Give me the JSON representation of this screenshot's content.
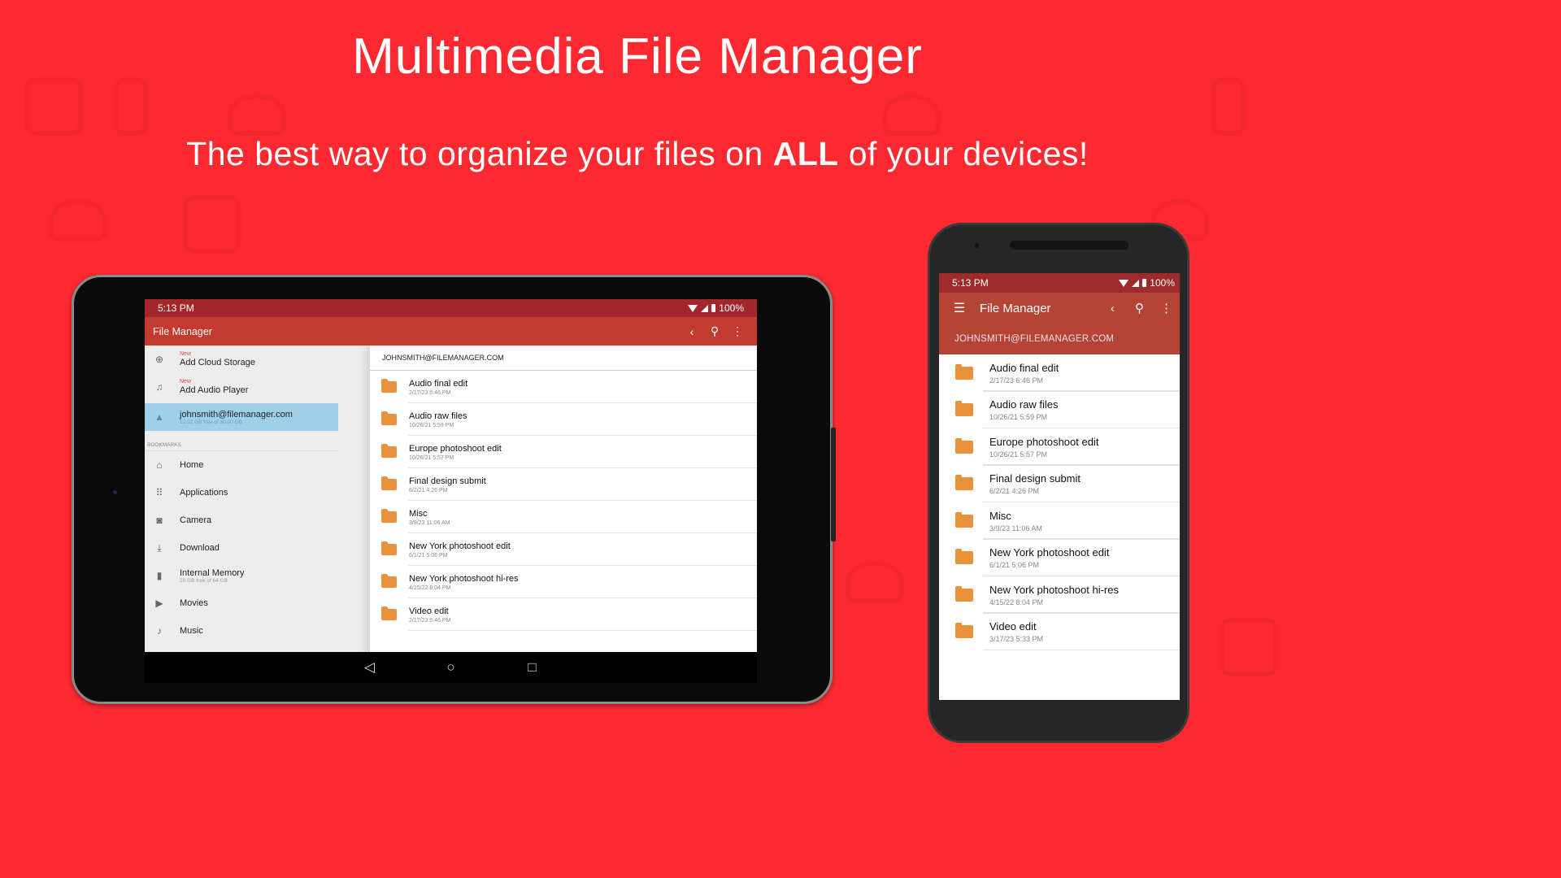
{
  "promo": {
    "headline": "Multimedia File Manager",
    "subline_before": "The best way to organize your files on ",
    "subline_bold": "ALL",
    "subline_after": " of your devices!",
    "background_color": "#fc2a30"
  },
  "status_bar": {
    "time": "5:13 PM",
    "battery": "100%",
    "icons": [
      "wifi-icon",
      "signal-icon",
      "battery-icon"
    ]
  },
  "app": {
    "title": "File Manager",
    "toolbar_icons": [
      "back-icon",
      "search-icon",
      "more-vert-icon"
    ],
    "primary_color": "#c33a30",
    "status_color": "#a2262a"
  },
  "tablet": {
    "sidebar": {
      "top_items": [
        {
          "badge": "New",
          "label": "Add Cloud Storage",
          "icon": "add-circle-icon"
        },
        {
          "badge": "New",
          "label": "Add Audio Player",
          "icon": "music-circle-icon"
        }
      ],
      "account": {
        "label": "johnsmith@filemanager.com",
        "sub": "12.32 GB free of 30.00 GB",
        "icon": "drive-icon"
      },
      "bookmarks_header": "BOOKMARKS",
      "bookmarks": [
        {
          "label": "Home",
          "icon": "home-icon"
        },
        {
          "label": "Applications",
          "icon": "apps-grid-icon"
        },
        {
          "label": "Camera",
          "icon": "camera-icon"
        },
        {
          "label": "Download",
          "icon": "download-icon"
        },
        {
          "label": "Internal Memory",
          "sub": "20 GB free of 64 GB",
          "icon": "sd-card-icon"
        },
        {
          "label": "Movies",
          "icon": "movies-icon"
        },
        {
          "label": "Music",
          "icon": "music-library-icon"
        }
      ]
    },
    "account_header": "JOHNSMITH@FILEMANAGER.COM",
    "files": [
      {
        "name": "Audio final edit",
        "date": "2/17/23 6:46 PM"
      },
      {
        "name": "Audio raw files",
        "date": "10/26/21 5:59 PM"
      },
      {
        "name": "Europe photoshoot edit",
        "date": "10/26/21 5:57 PM"
      },
      {
        "name": "Final design submit",
        "date": "6/2/21 4:26 PM"
      },
      {
        "name": "Misc",
        "date": "3/9/23 11:06 AM"
      },
      {
        "name": "New York photoshoot edit",
        "date": "6/1/21 5:06 PM"
      },
      {
        "name": "New York photoshoot hi-res",
        "date": "4/15/22 8:04 PM"
      },
      {
        "name": "Video edit",
        "date": "2/17/23 6:46 PM"
      }
    ],
    "nav": {
      "back": "◁",
      "home": "○",
      "recents": "□"
    }
  },
  "phone": {
    "account_header": "JOHNSMITH@FILEMANAGER.COM",
    "files": [
      {
        "name": "Audio final edit",
        "date": "2/17/23 6:46 PM"
      },
      {
        "name": "Audio raw files",
        "date": "10/26/21 5:59 PM"
      },
      {
        "name": "Europe photoshoot edit",
        "date": "10/26/21 5:57 PM"
      },
      {
        "name": "Final design submit",
        "date": "6/2/21 4:26 PM"
      },
      {
        "name": "Misc",
        "date": "3/9/23 11:06 AM"
      },
      {
        "name": "New York photoshoot edit",
        "date": "6/1/21 5:06 PM"
      },
      {
        "name": "New York photoshoot hi-res",
        "date": "4/15/22 8:04 PM"
      },
      {
        "name": "Video edit",
        "date": "3/17/23 5:33 PM"
      }
    ]
  },
  "glyphs": {
    "back": "‹",
    "search": "⚲",
    "more": "⋮",
    "menu": "☰",
    "add": "⊕",
    "music": "♫",
    "drive": "▲",
    "home": "⌂",
    "apps": "⠿",
    "camera": "◙",
    "download": "⤓",
    "sd": "▮",
    "movies": "▶",
    "musiclib": "♪"
  }
}
